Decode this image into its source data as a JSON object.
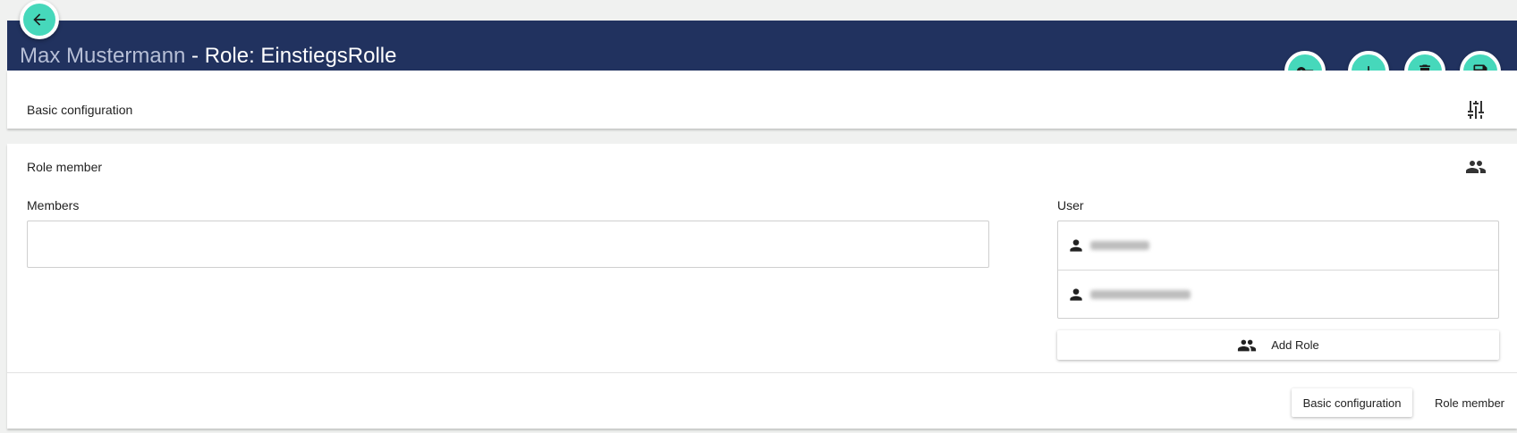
{
  "header": {
    "user_name": "Max Mustermann",
    "role_text": " - Role: EinstiegsRolle"
  },
  "actions": {
    "back": "arrow-left-icon",
    "key": "key-icon",
    "add": "plus-icon",
    "delete": "trash-icon",
    "save": "floppy-disk-icon"
  },
  "basic_config": {
    "title": "Basic configuration",
    "icon": "sliders-icon"
  },
  "role_member": {
    "title": "Role member",
    "icon": "people-icon",
    "members_label": "Members",
    "user_label": "User",
    "add_role_label": "Add Role"
  },
  "stepper": {
    "basic_label": "Basic configuration",
    "member_label": "Role member"
  },
  "colors": {
    "header_bg": "#21325f",
    "accent": "#46d8bb"
  }
}
